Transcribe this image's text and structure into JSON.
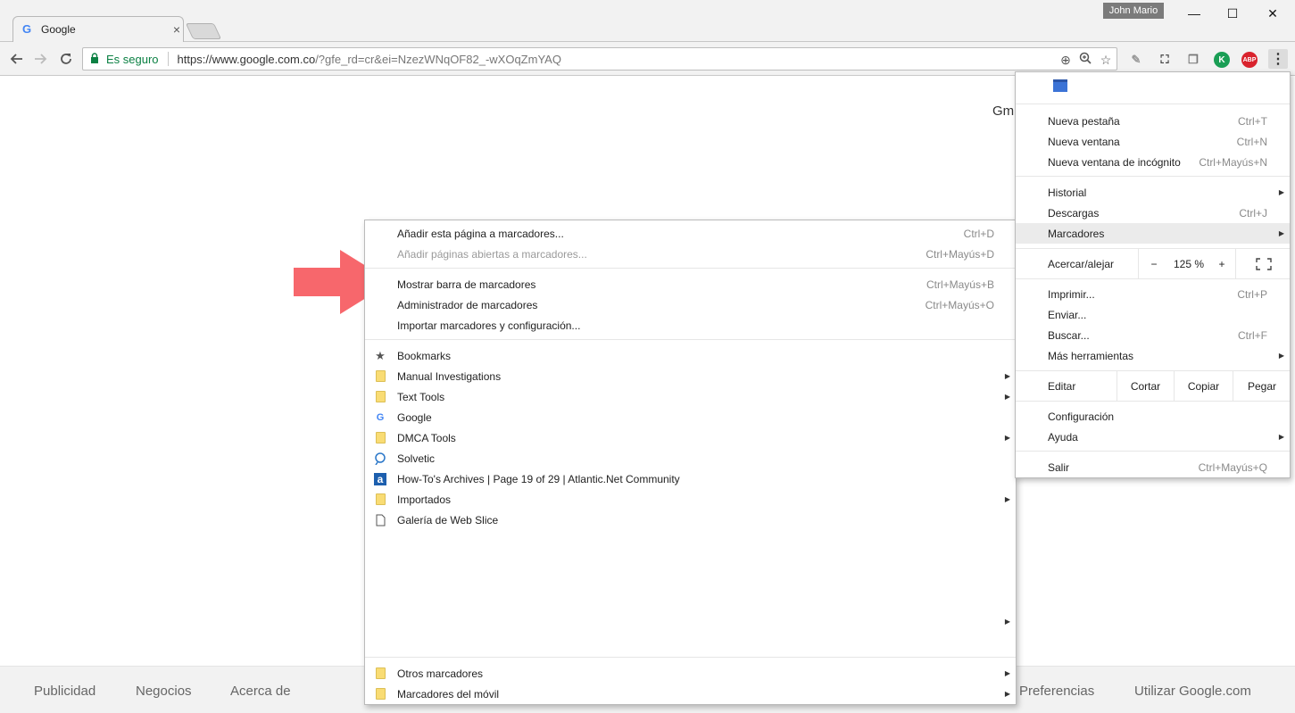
{
  "window": {
    "tab_title": "Google",
    "tab_favicon": "G",
    "tab_close": "×",
    "user_name": "John Mario",
    "minimize": "—",
    "maximize": "☐",
    "close": "✕"
  },
  "toolbar": {
    "secure_label": "Es seguro",
    "url_main": "https://www.google.com.co",
    "url_rest": "/?gfe_rd=cr&ei=NzezWNqOF82_-wXOqZmYAQ",
    "ext_abp": "ABP",
    "ext_k": "K"
  },
  "page": {
    "gmail_link": "Gm",
    "footer": {
      "publicidad": "Publicidad",
      "negocios": "Negocios",
      "acerca": "Acerca de",
      "preferencias": "Preferencias",
      "utilizar": "Utilizar Google.com"
    }
  },
  "bookmarks_menu": {
    "add_page": {
      "label": "Añadir esta página a marcadores...",
      "shortcut": "Ctrl+D"
    },
    "add_open": {
      "label": "Añadir páginas abiertas a marcadores...",
      "shortcut": "Ctrl+Mayús+D"
    },
    "show_bar": {
      "label": "Mostrar barra de marcadores",
      "shortcut": "Ctrl+Mayús+B"
    },
    "manager": {
      "label": "Administrador de marcadores",
      "shortcut": "Ctrl+Mayús+O"
    },
    "import": {
      "label": "Importar marcadores y configuración..."
    },
    "items": [
      {
        "label": "Bookmarks",
        "icon": "star-icon",
        "submenu": false
      },
      {
        "label": "Manual Investigations",
        "icon": "folder-icon",
        "submenu": true
      },
      {
        "label": "Text Tools",
        "icon": "folder-icon",
        "submenu": true
      },
      {
        "label": "Google",
        "icon": "google-icon",
        "submenu": false
      },
      {
        "label": "DMCA Tools",
        "icon": "folder-icon",
        "submenu": true
      },
      {
        "label": "Solvetic",
        "icon": "solvetic-icon",
        "submenu": false
      },
      {
        "label": "How-To's Archives | Page 19 of 29 | Atlantic.Net Community",
        "icon": "atlantic-icon",
        "submenu": false
      },
      {
        "label": "Importados",
        "icon": "folder-icon",
        "submenu": true
      },
      {
        "label": "Galería de Web Slice",
        "icon": "page-icon",
        "submenu": false
      }
    ],
    "other": {
      "label": "Otros marcadores"
    },
    "mobile": {
      "label": "Marcadores del móvil"
    }
  },
  "main_menu": {
    "new_tab": {
      "label": "Nueva pestaña",
      "shortcut": "Ctrl+T"
    },
    "new_window": {
      "label": "Nueva ventana",
      "shortcut": "Ctrl+N"
    },
    "incognito": {
      "label": "Nueva ventana de incógnito",
      "shortcut": "Ctrl+Mayús+N"
    },
    "history": {
      "label": "Historial"
    },
    "downloads": {
      "label": "Descargas",
      "shortcut": "Ctrl+J"
    },
    "bookmarks": {
      "label": "Marcadores"
    },
    "zoom": {
      "label": "Acercar/alejar",
      "minus": "−",
      "value": "125 %",
      "plus": "+"
    },
    "print": {
      "label": "Imprimir...",
      "shortcut": "Ctrl+P"
    },
    "cast": {
      "label": "Enviar..."
    },
    "find": {
      "label": "Buscar...",
      "shortcut": "Ctrl+F"
    },
    "more_tools": {
      "label": "Más herramientas"
    },
    "edit": {
      "label": "Editar",
      "cut": "Cortar",
      "copy": "Copiar",
      "paste": "Pegar"
    },
    "settings": {
      "label": "Configuración"
    },
    "help": {
      "label": "Ayuda"
    },
    "exit": {
      "label": "Salir",
      "shortcut": "Ctrl+Mayús+Q"
    }
  },
  "colors": {
    "arrow": "#f7676c",
    "secure": "#0b8043",
    "highlight": "#ebebeb"
  }
}
